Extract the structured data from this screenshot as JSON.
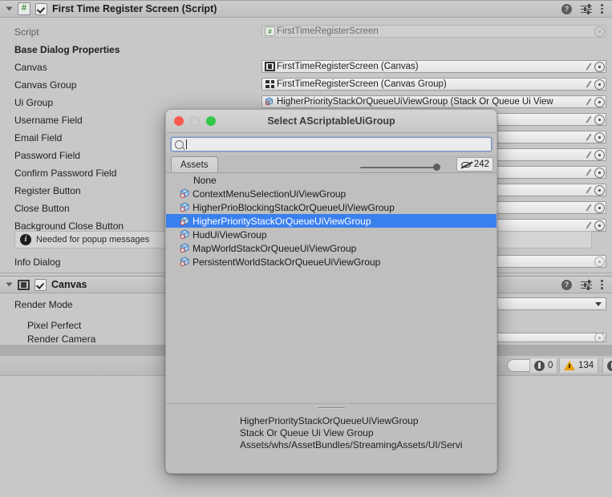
{
  "inspector": {
    "components": [
      {
        "title": "First Time Register Screen (Script)",
        "badge_icon": "script-badge-icon",
        "enabled": true,
        "expanded": true
      },
      {
        "title": "Canvas",
        "badge_icon": "canvas-badge-icon",
        "enabled": true,
        "expanded": true
      }
    ],
    "header_icons": [
      "help-icon",
      "preset-icon",
      "kebab-menu-icon"
    ],
    "script_row": {
      "label": "Script",
      "value": "FirstTimeRegisterScreen",
      "icon": "script-file-icon",
      "disabled": true
    },
    "section_header": "Base Dialog Properties",
    "properties": [
      {
        "label": "Canvas",
        "value": "FirstTimeRegisterScreen (Canvas)",
        "icon": "canvas-icon"
      },
      {
        "label": "Canvas Group",
        "value": "FirstTimeRegisterScreen (Canvas Group)",
        "icon": "canvas-group-icon"
      },
      {
        "label": "Ui Group",
        "value": "HigherPriorityStackOrQueueUiViewGroup (Stack Or Queue Ui View",
        "icon": "scriptable-object-icon"
      },
      {
        "label": "Username Field",
        "value": "",
        "icon": ""
      },
      {
        "label": "Email Field",
        "value": "",
        "icon": ""
      },
      {
        "label": "Password Field",
        "value": "",
        "icon": ""
      },
      {
        "label": "Confirm Password Field",
        "value": "",
        "icon": ""
      },
      {
        "label": "Register Button",
        "value": "",
        "icon": ""
      },
      {
        "label": "Close Button",
        "value": "",
        "icon": ""
      },
      {
        "label": "Background Close Button",
        "value": "",
        "icon": ""
      }
    ],
    "info_box": {
      "text": "Needed for popup messages",
      "icon": "info-icon"
    },
    "info_dialog_row": {
      "label": "Info Dialog",
      "value": ""
    },
    "canvas_section": {
      "rows": [
        {
          "label": "Render Mode",
          "value": ""
        },
        {
          "label": "Pixel Perfect",
          "value": ""
        },
        {
          "label": "Render Camera",
          "value": ""
        }
      ]
    }
  },
  "statusbar": {
    "console_count": "0",
    "warning_count": "134",
    "console_icon": "console-log-icon",
    "warning_icon": "warning-triangle-icon"
  },
  "modal": {
    "title": "Select AScriptableUiGroup",
    "traffic_lights": [
      "close-button",
      "minimize-button",
      "zoom-button"
    ],
    "search": {
      "placeholder": "",
      "value": "",
      "icon": "search-icon"
    },
    "tabs": [
      {
        "label": "Assets",
        "active": true
      }
    ],
    "hidden_count": "242",
    "hidden_icon": "eye-off-icon",
    "list": [
      {
        "label": "None",
        "icon": "",
        "selected": false
      },
      {
        "label": "ContextMenuSelectionUiViewGroup",
        "icon": "scriptable-object-icon",
        "selected": false
      },
      {
        "label": "HigherPrioBlockingStackOrQueueUiViewGroup",
        "icon": "scriptable-object-icon",
        "selected": false
      },
      {
        "label": "HigherPriorityStackOrQueueUiViewGroup",
        "icon": "scriptable-object-icon",
        "selected": true
      },
      {
        "label": "HudUiViewGroup",
        "icon": "scriptable-object-icon",
        "selected": false
      },
      {
        "label": "MapWorldStackOrQueueUiViewGroup",
        "icon": "scriptable-object-icon",
        "selected": false
      },
      {
        "label": "PersistentWorldStackOrQueueUiViewGroup",
        "icon": "scriptable-object-icon",
        "selected": false
      }
    ],
    "preview": {
      "name": "HigherPriorityStackOrQueueUiViewGroup",
      "type": "Stack Or Queue Ui View Group",
      "path": "Assets/whs/AssetBundles/StreamingAssets/UI/Servi"
    }
  },
  "colors": {
    "inspector_bg": "#c8c8c8",
    "modal_bg": "#c2c2c2",
    "selection_blue": "#3a7fee",
    "warning_amber": "#e8a200",
    "traffic_red": "#fb5a51",
    "traffic_green": "#33c748"
  }
}
